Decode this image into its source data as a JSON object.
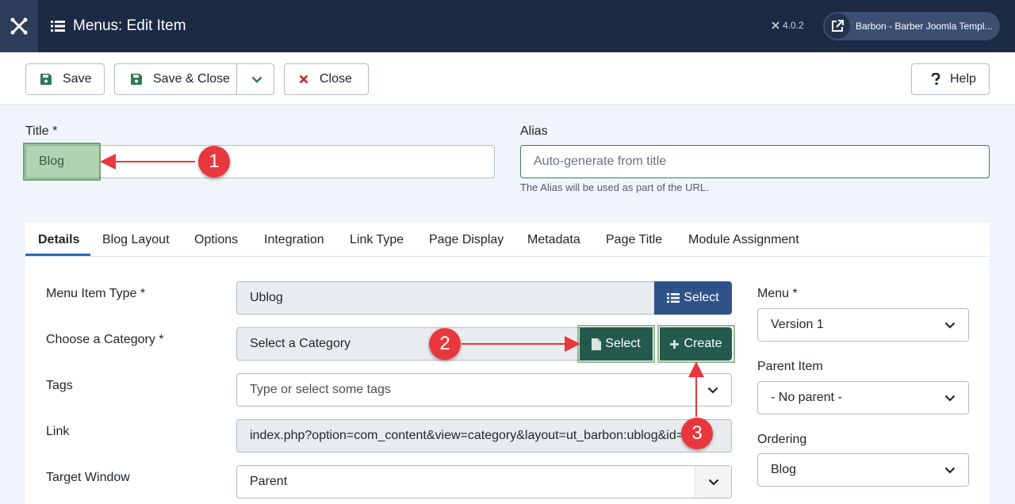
{
  "header": {
    "title": "Menus: Edit Item",
    "version": "4.0.2",
    "site_name": "Barbon - Barber Joomla Templ..."
  },
  "toolbar": {
    "save_label": "Save",
    "save_close_label": "Save & Close",
    "close_label": "Close",
    "help_label": "Help"
  },
  "form": {
    "title_label": "Title *",
    "title_value": "Blog",
    "alias_label": "Alias",
    "alias_placeholder": "Auto-generate from title",
    "alias_hint": "The Alias will be used as part of the URL."
  },
  "tabs": [
    "Details",
    "Blog Layout",
    "Options",
    "Integration",
    "Link Type",
    "Page Display",
    "Metadata",
    "Page Title",
    "Module Assignment"
  ],
  "details": {
    "menu_item_type_label": "Menu Item Type *",
    "menu_item_type_value": "Ublog",
    "select_label": "Select",
    "category_label": "Choose a Category *",
    "category_value": "Select a Category",
    "category_select_label": "Select",
    "category_create_label": "Create",
    "tags_label": "Tags",
    "tags_placeholder": "Type or select some tags",
    "link_label": "Link",
    "link_value": "index.php?option=com_content&view=category&layout=ut_barbon:ublog&id=",
    "target_label": "Target Window",
    "target_value": "Parent"
  },
  "sidebar": {
    "menu_label": "Menu *",
    "menu_value": "Version 1",
    "parent_label": "Parent Item",
    "parent_value": "- No parent -",
    "ordering_label": "Ordering",
    "ordering_value": "Blog"
  },
  "annotations": [
    "1",
    "2",
    "3"
  ],
  "colors": {
    "header_bg": "#1c2a44",
    "primary_blue": "#2f5289",
    "success_green": "#235a4b",
    "annotation_red": "#e8383d"
  }
}
